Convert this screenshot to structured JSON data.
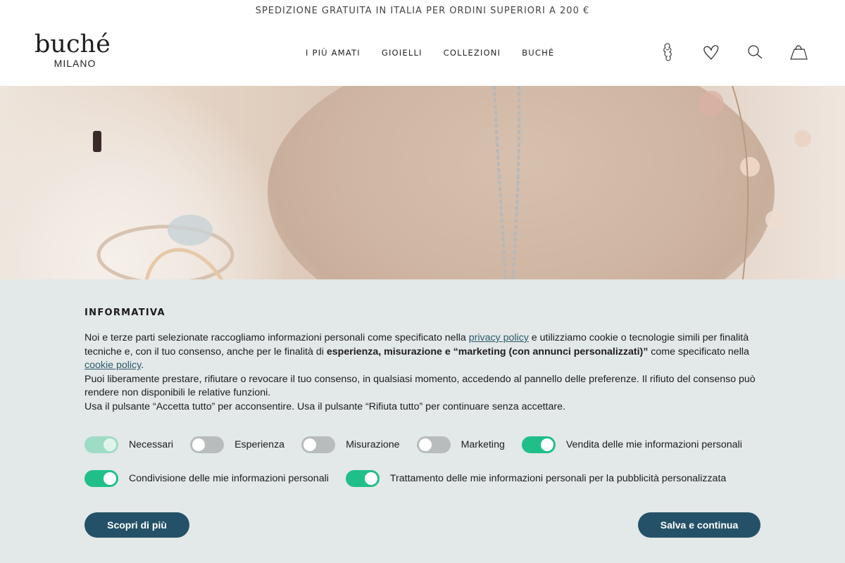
{
  "announcement": "SPEDIZIONE GRATUITA IN ITALIA PER ORDINI SUPERIORI A 200 €",
  "logo": {
    "main": "buché",
    "sub": "MILANO"
  },
  "nav": [
    "I PIÙ AMATI",
    "GIOIELLI",
    "COLLEZIONI",
    "BUCHÉ"
  ],
  "header_icons": [
    "account-icon",
    "heart-icon",
    "search-icon",
    "shopping-bag-icon"
  ],
  "cookie": {
    "title": "INFORMATIVA",
    "p1_a": "Noi e terze parti selezionate raccogliamo informazioni personali come specificato nella ",
    "privacy_link": "privacy policy",
    "p1_b": " e utilizziamo cookie o tecnologie simili per finalità tecniche e, con il tuo consenso, anche per le finalità di ",
    "p1_bold": "esperienza, misurazione e “marketing (con annunci personalizzati)”",
    "p1_c": " come specificato nella ",
    "cookie_link": "cookie policy",
    "p1_d": ".",
    "p2": "Puoi liberamente prestare, rifiutare o revocare il tuo consenso, in qualsiasi momento, accedendo al pannello delle preferenze. Il rifiuto del consenso può rendere non disponibili le relative funzioni.",
    "p3": "Usa il pulsante “Accetta tutto” per acconsentire. Usa il pulsante “Rifiuta tutto” per continuare senza accettare.",
    "toggles_row1": [
      {
        "label": "Necessari",
        "state": "disabled-on"
      },
      {
        "label": "Esperienza",
        "state": "off"
      },
      {
        "label": "Misurazione",
        "state": "off"
      },
      {
        "label": "Marketing",
        "state": "off"
      },
      {
        "label": "Vendita delle mie informazioni personali",
        "state": "on"
      }
    ],
    "toggles_row2": [
      {
        "label": "Condivisione delle mie informazioni personali",
        "state": "on"
      },
      {
        "label": "Trattamento delle mie informazioni personali per la pubblicità personalizzata",
        "state": "on"
      }
    ],
    "learn_more": "Scopri di più",
    "save": "Salva e continua"
  },
  "colors": {
    "toggle_on": "#20bf8a",
    "toggle_off": "#b9bcbc",
    "button": "#245167",
    "panel": "#e3e8e8",
    "link": "#2c5a6a"
  }
}
